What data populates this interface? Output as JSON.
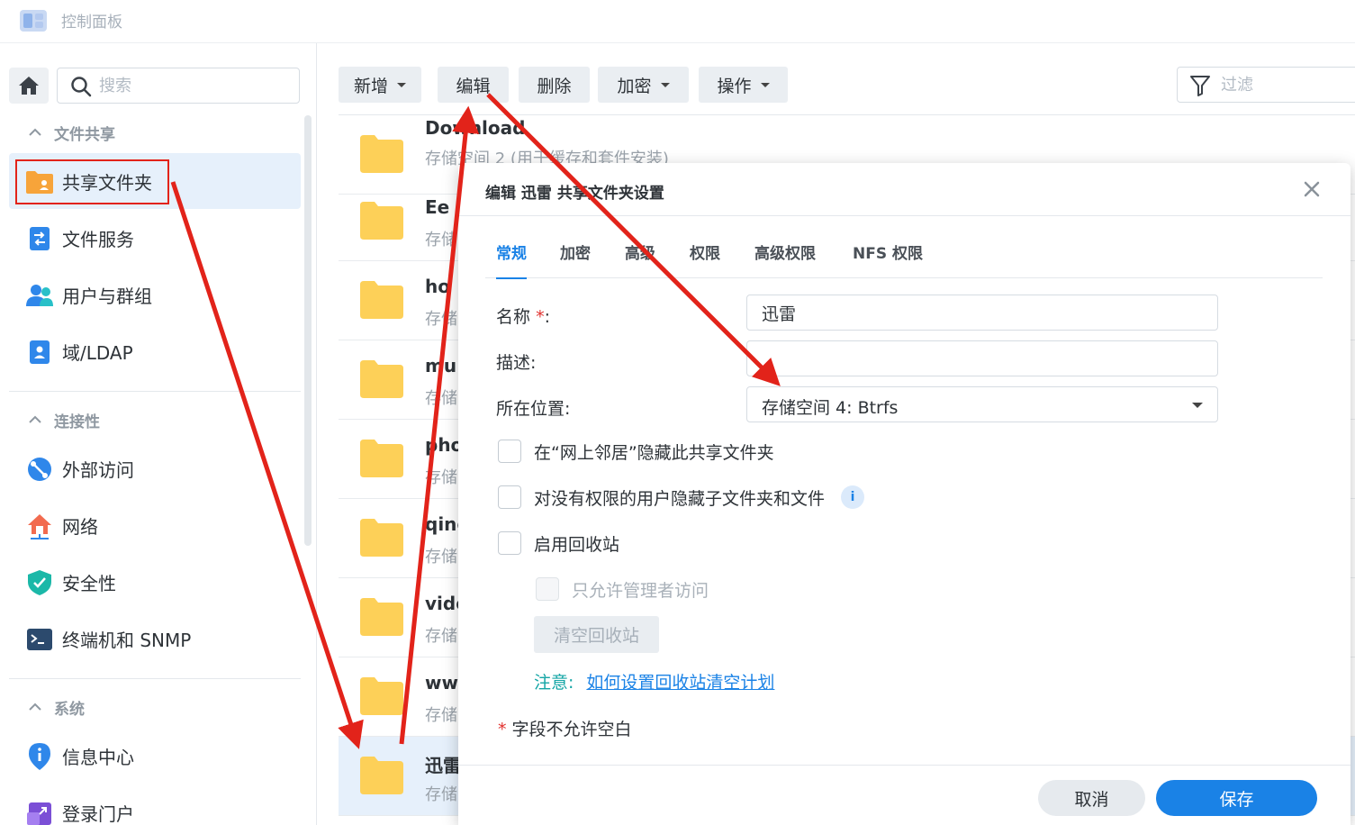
{
  "app": {
    "title": "控制面板"
  },
  "search": {
    "placeholder": "搜索"
  },
  "sidebar": {
    "sections": [
      {
        "label": "文件共享"
      },
      {
        "label": "连接性"
      },
      {
        "label": "系统"
      }
    ],
    "items": [
      {
        "label": "共享文件夹",
        "icon": "shared-folder-icon",
        "active": true
      },
      {
        "label": "文件服务",
        "icon": "file-services-icon"
      },
      {
        "label": "用户与群组",
        "icon": "users-groups-icon"
      },
      {
        "label": "域/LDAP",
        "icon": "domain-ldap-icon"
      },
      {
        "label": "外部访问",
        "icon": "external-access-icon"
      },
      {
        "label": "网络",
        "icon": "network-icon"
      },
      {
        "label": "安全性",
        "icon": "security-shield-icon"
      },
      {
        "label": "终端机和 SNMP",
        "icon": "terminal-icon"
      },
      {
        "label": "信息中心",
        "icon": "info-center-icon"
      },
      {
        "label": "登录门户",
        "icon": "login-portal-icon"
      }
    ]
  },
  "toolbar": {
    "add_label": "新增",
    "edit_label": "编辑",
    "delete_label": "删除",
    "encrypt_label": "加密",
    "action_label": "操作",
    "filter_placeholder": "过滤"
  },
  "folders": [
    {
      "name": "Download",
      "sub": "存储空间 2 (用于缓存和套件安装)"
    },
    {
      "name": "Ee",
      "sub": "存储"
    },
    {
      "name": "ho",
      "sub": "存储"
    },
    {
      "name": "mu",
      "sub": "存储"
    },
    {
      "name": "pho",
      "sub": "存储"
    },
    {
      "name": "qing",
      "sub": "存储"
    },
    {
      "name": "vide",
      "sub": "存储"
    },
    {
      "name": "ww",
      "sub": "存储"
    },
    {
      "name": "迅雷",
      "sub": "存储",
      "selected": true
    }
  ],
  "dialog": {
    "title": "编辑 迅雷 共享文件夹设置",
    "tabs": [
      "常规",
      "加密",
      "高级",
      "权限",
      "高级权限",
      "NFS 权限"
    ],
    "fields": {
      "name_label": "名称",
      "name_req": "*",
      "name_colon": ":",
      "name_value": "迅雷",
      "desc_label": "描述:",
      "desc_value": "",
      "location_label": "所在位置:",
      "location_value": "存储空间 4:   Btrfs"
    },
    "options": {
      "hide_network": "在“网上邻居”隐藏此共享文件夹",
      "hide_subfolders": "对没有权限的用户隐藏子文件夹和文件",
      "recycle_bin": "启用回收站",
      "admin_only": "只允许管理者访问"
    },
    "clear_recycle_label": "清空回收站",
    "note_label": "注意:",
    "note_link": "如何设置回收站清空计划",
    "required_star": "*",
    "required_note": "字段不允许空白",
    "cancel_label": "取消",
    "save_label": "保存"
  },
  "colors": {
    "accent": "#1a82e6",
    "annotation": "#e2231a",
    "folder": "#fdd058",
    "note": "#13a5a5"
  }
}
